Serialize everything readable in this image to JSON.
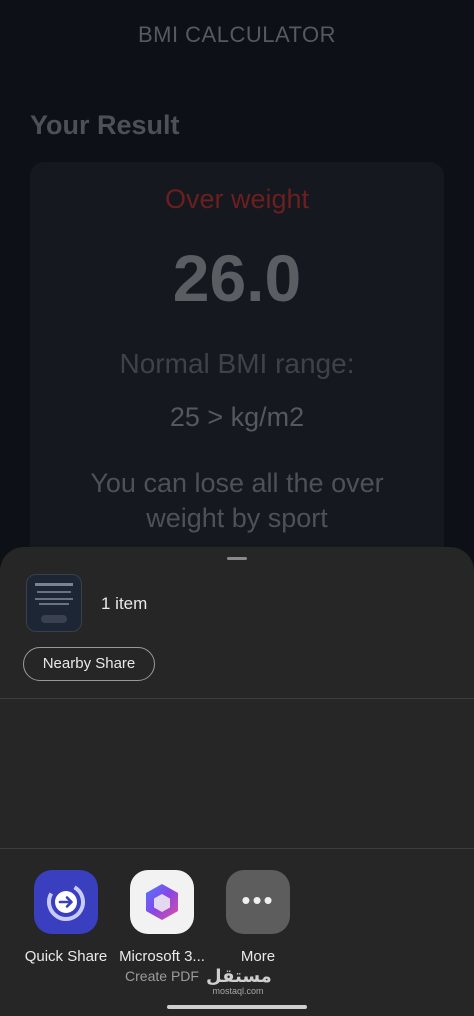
{
  "app": {
    "title": "BMI CALCULATOR",
    "result_title": "Your Result",
    "status": "Over weight",
    "status_color": "#6b1f1f",
    "bmi_value": "26.0",
    "range_label": "Normal BMI range:",
    "range_value": "25 >  kg/m2",
    "advice": "You can lose all the over weight by sport"
  },
  "share_sheet": {
    "item_count": "1 item",
    "nearby_share_label": "Nearby Share",
    "apps": [
      {
        "label": "Quick Share",
        "icon": "quick-share-icon",
        "color": "#3a3fbf"
      },
      {
        "label": "Microsoft 3...",
        "sublabel": "Create PDF",
        "icon": "microsoft-365-icon",
        "color": "#f2f2f2"
      },
      {
        "label": "More",
        "icon": "more-dots-icon",
        "color": "#5d5d5d"
      }
    ]
  },
  "watermark": {
    "main": "مستقل",
    "sub": "mostaql.com"
  }
}
